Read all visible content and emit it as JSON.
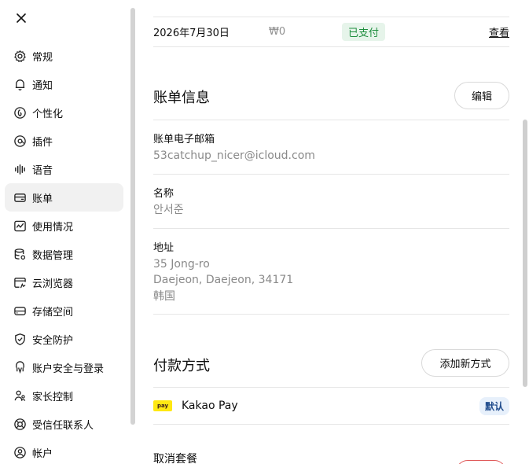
{
  "sidebar": {
    "close_icon": "close-icon",
    "items": [
      {
        "label": "常规",
        "icon": "gear-icon"
      },
      {
        "label": "通知",
        "icon": "bell-icon"
      },
      {
        "label": "个性化",
        "icon": "personalize-icon"
      },
      {
        "label": "插件",
        "icon": "plugin-icon"
      },
      {
        "label": "语音",
        "icon": "waveform-icon"
      },
      {
        "label": "账单",
        "icon": "card-icon"
      },
      {
        "label": "使用情况",
        "icon": "activity-icon"
      },
      {
        "label": "数据管理",
        "icon": "database-icon"
      },
      {
        "label": "云浏览器",
        "icon": "cloud-browser-icon"
      },
      {
        "label": "存储空间",
        "icon": "storage-icon"
      },
      {
        "label": "安全防护",
        "icon": "shield-icon"
      },
      {
        "label": "账户安全与登录",
        "icon": "lock-account-icon"
      },
      {
        "label": "家长控制",
        "icon": "parent-icon"
      },
      {
        "label": "受信任联系人",
        "icon": "lifebuoy-icon"
      },
      {
        "label": "帐户",
        "icon": "user-icon"
      }
    ],
    "active_index": 5
  },
  "invoice": {
    "date": "2026年7月30日",
    "amount": "₩0",
    "status": "已支付",
    "view_label": "查看"
  },
  "billing_info": {
    "title": "账单信息",
    "edit_label": "编辑",
    "email_label": "账单电子邮箱",
    "email_value": "53catchup_nicer@icloud.com",
    "name_label": "名称",
    "name_value": "안서준",
    "address_label": "地址",
    "address_line1": "35 Jong-ro",
    "address_line2": "Daejeon, Daejeon, 34171",
    "address_line3": "韩国"
  },
  "payment": {
    "title": "付款方式",
    "add_label": "添加新方式",
    "method_name": "Kakao Pay",
    "logo_text": "pay",
    "default_badge": "默认"
  },
  "cancel": {
    "title": "取消套餐"
  },
  "colors": {
    "accent_green": "#1e8e3e",
    "badge_blue": "#1f4b8c",
    "danger": "#e05a5a",
    "kakao_yellow": "#ffe812"
  }
}
